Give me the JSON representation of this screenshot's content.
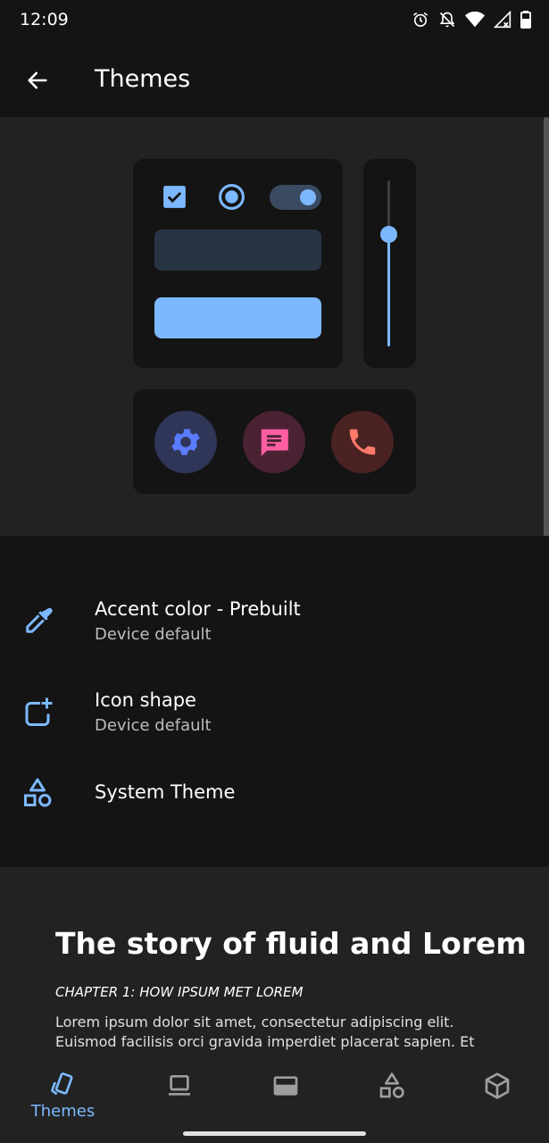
{
  "status_bar": {
    "time": "12:09"
  },
  "app_bar": {
    "title": "Themes"
  },
  "settings": [
    {
      "title": "Accent color - Prebuilt",
      "subtitle": "Device default",
      "icon": "eyedropper-icon"
    },
    {
      "title": "Icon shape",
      "subtitle": "Device default",
      "icon": "icon-shape-icon"
    },
    {
      "title": "System Theme",
      "subtitle": "",
      "icon": "shapes-icon"
    }
  ],
  "story": {
    "title": "The story of fluid and Lorem",
    "chapter": "CHAPTER 1: HOW IPSUM MET LOREM",
    "body": "Lorem ipsum dolor sit amet, consectetur adipiscing elit. Euismod facilisis orci gravida imperdiet placerat sapien. Et"
  },
  "bottom_nav": {
    "items": [
      {
        "label": "Themes",
        "icon": "themes-icon",
        "active": true
      },
      {
        "label": "",
        "icon": "laptop-icon",
        "active": false
      },
      {
        "label": "",
        "icon": "window-icon",
        "active": false
      },
      {
        "label": "",
        "icon": "shapes-icon",
        "active": false
      },
      {
        "label": "",
        "icon": "cube-icon",
        "active": false
      }
    ]
  },
  "colors": {
    "accent": "#7cb8ff",
    "background": "#141414",
    "surface": "#222222",
    "settings_icon_bg": "#2f3657",
    "settings_icon_fg": "#5b7cff",
    "message_icon_bg": "#4a2233",
    "message_icon_fg": "#ff5fa2",
    "phone_icon_bg": "#4a2222",
    "phone_icon_fg": "#ff7a6b"
  },
  "preview": {
    "slider_level": 0.67
  }
}
